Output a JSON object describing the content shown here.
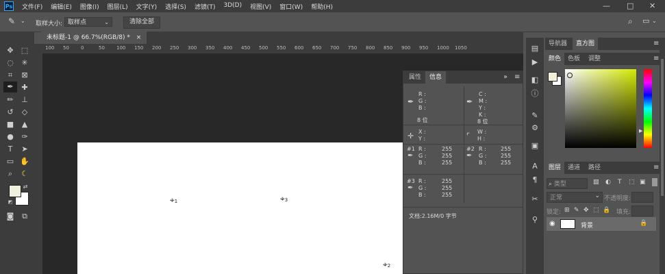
{
  "menubar": {
    "logo": "Ps",
    "items": [
      "文件(F)",
      "编辑(E)",
      "图像(I)",
      "图层(L)",
      "文字(Y)",
      "选择(S)",
      "滤镜(T)",
      "3D(D)",
      "视图(V)",
      "窗口(W)",
      "帮助(H)"
    ],
    "minimize": "—",
    "maximize": "□",
    "close": "✕"
  },
  "options": {
    "sample_size_label": "取样大小:",
    "sample_size_value": "取样点",
    "clear_all": "清除全部"
  },
  "document": {
    "tab_title": "未标题-1 @ 66.7%(RGB/8) *",
    "tab_close": "×"
  },
  "ruler": {
    "top_ticks": [
      "100",
      "50",
      "0",
      "50",
      "100",
      "150",
      "200",
      "250",
      "300",
      "350",
      "400",
      "450",
      "500",
      "550",
      "600",
      "650",
      "700",
      "750",
      "800",
      "850",
      "900",
      "950",
      "1000",
      "1050"
    ]
  },
  "samplers": [
    {
      "num": "1"
    },
    {
      "num": "3"
    },
    {
      "num": "2"
    }
  ],
  "info_panel": {
    "tabs": [
      "属性",
      "信息"
    ],
    "active_tab": "信息",
    "menu_glyph": "≡",
    "collapse_glyph": "»",
    "rgb_labels": [
      "R :",
      "G :",
      "B :"
    ],
    "cmyk_labels": [
      "C :",
      "M :",
      "Y :",
      "K :"
    ],
    "bit_left": "8 位",
    "bit_right": "8 位",
    "xy_labels": [
      "X :",
      "Y :"
    ],
    "wh_labels": [
      "W :",
      "H :"
    ],
    "s1": {
      "id": "#1",
      "values": [
        "255",
        "255",
        "255"
      ]
    },
    "s2": {
      "id": "#2",
      "values": [
        "255",
        "255",
        "255"
      ]
    },
    "s3": {
      "id": "#3",
      "values": [
        "255",
        "255",
        "255"
      ]
    },
    "doc_size": "文档:2.16M/0 字节"
  },
  "navigator_panel": {
    "tabs": [
      "导航器",
      "直方图"
    ],
    "active_tab": "直方图",
    "menu_glyph": "≡"
  },
  "color_panel": {
    "tabs": [
      "颜色",
      "色板",
      "调整"
    ],
    "active_tab": "颜色",
    "menu_glyph": "≡",
    "foreground": "#f0f0dc",
    "background": "#ffffff"
  },
  "layers_panel": {
    "tabs": [
      "图层",
      "通道",
      "路径"
    ],
    "active_tab": "图层",
    "menu_glyph": "≡",
    "filter_placeholder": "类型",
    "blend_mode": "正常",
    "opacity_label": "不透明度:",
    "lock_label": "锁定:",
    "fill_label": "填充:",
    "layer_name": "背景"
  }
}
